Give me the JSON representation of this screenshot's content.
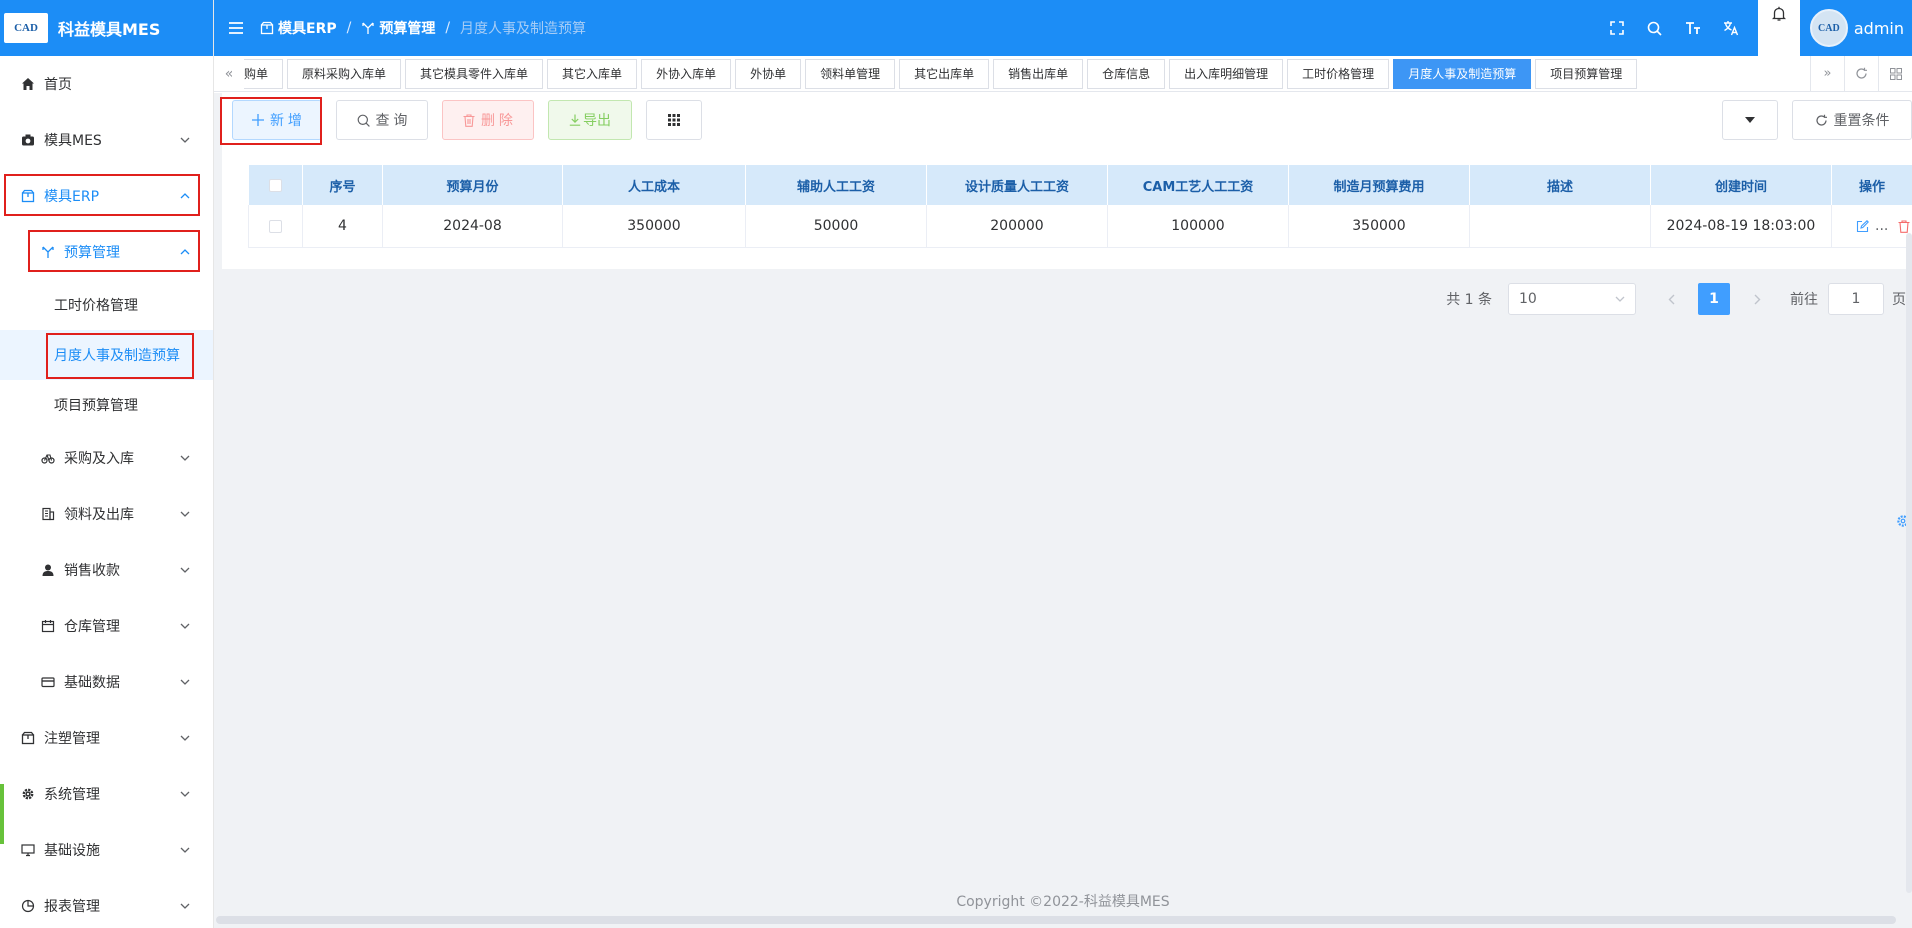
{
  "logo": {
    "badge": "CAD",
    "title": "科益模具MES"
  },
  "sidebar": {
    "items": [
      {
        "label": "首页",
        "icon": "home-icon"
      },
      {
        "label": "模具MES",
        "icon": "camera-icon"
      },
      {
        "label": "模具ERP",
        "icon": "box-icon"
      },
      {
        "label": "预算管理",
        "icon": "budget-icon"
      },
      {
        "label": "工时价格管理"
      },
      {
        "label": "月度人事及制造预算"
      },
      {
        "label": "项目预算管理"
      },
      {
        "label": "采购及入库",
        "icon": "bike-icon"
      },
      {
        "label": "领料及出库",
        "icon": "building-icon"
      },
      {
        "label": "销售收款",
        "icon": "user-icon"
      },
      {
        "label": "仓库管理",
        "icon": "calendar-icon"
      },
      {
        "label": "基础数据",
        "icon": "card-icon"
      },
      {
        "label": "注塑管理",
        "icon": "box-icon"
      },
      {
        "label": "系统管理",
        "icon": "gear-icon"
      },
      {
        "label": "基础设施",
        "icon": "monitor-icon"
      },
      {
        "label": "报表管理",
        "icon": "chart-icon"
      }
    ]
  },
  "breadcrumb": [
    "模具ERP",
    "预算管理",
    "月度人事及制造预算"
  ],
  "header": {
    "username": "admin",
    "avatar_text": "CAD"
  },
  "tabs": [
    "购单",
    "原料采购入库单",
    "其它模具零件入库单",
    "其它入库单",
    "外协入库单",
    "外协单",
    "领料单管理",
    "其它出库单",
    "销售出库单",
    "仓库信息",
    "出入库明细管理",
    "工时价格管理",
    "月度人事及制造预算",
    "项目预算管理"
  ],
  "toolbar": {
    "add": "新 增",
    "query": "查 询",
    "delete": "删 除",
    "export": "导出",
    "reset": "重置条件"
  },
  "table": {
    "columns": [
      "序号",
      "预算月份",
      "人工成本",
      "辅助人工工资",
      "设计质量人工工资",
      "CAM工艺人工工资",
      "制造月预算费用",
      "描述",
      "创建时间",
      "操作"
    ],
    "rows": [
      {
        "index": "4",
        "month": "2024-08",
        "labor": "350000",
        "aux": "50000",
        "design": "200000",
        "cam": "100000",
        "manufacture": "350000",
        "desc": "",
        "created": "2024-08-19 18:03:00",
        "more": "..."
      }
    ]
  },
  "pager": {
    "total": "共 1 条",
    "page_size": "10",
    "current": "1",
    "goto_label": "前往",
    "goto_value": "1",
    "page_unit": "页"
  },
  "footer": "Copyright ©2022-科益模具MES"
}
